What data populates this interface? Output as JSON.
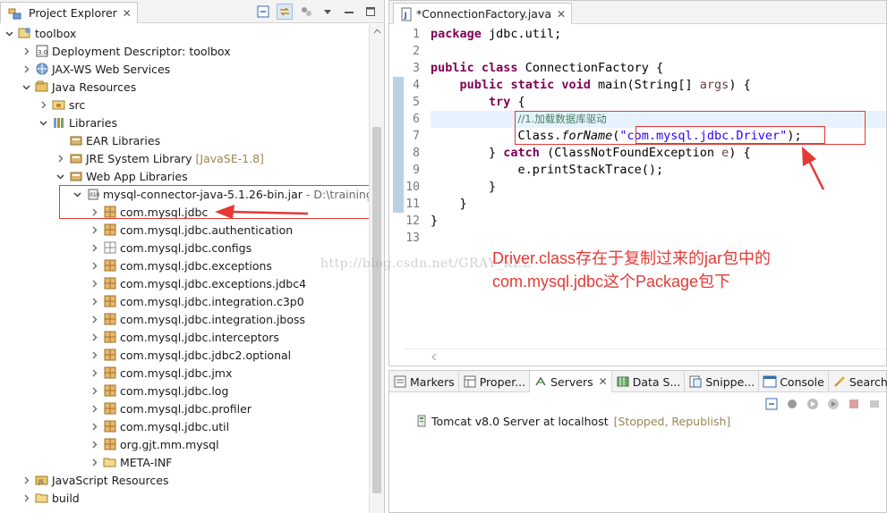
{
  "project_explorer": {
    "title": "Project Explorer",
    "close_glyph": "✕",
    "tree": [
      {
        "label": "toolbox",
        "icon": "project-icon",
        "expanded": true,
        "level": 0
      },
      {
        "label": "Deployment Descriptor: toolbox",
        "icon": "deployment-descriptor-icon",
        "expanded": false,
        "level": 1
      },
      {
        "label": "JAX-WS Web Services",
        "icon": "web-services-icon",
        "expanded": false,
        "level": 1
      },
      {
        "label": "Java Resources",
        "icon": "java-resources-icon",
        "expanded": true,
        "level": 1
      },
      {
        "label": "src",
        "icon": "source-folder-icon",
        "expanded": false,
        "level": 2
      },
      {
        "label": "Libraries",
        "icon": "libraries-icon",
        "expanded": true,
        "level": 2
      },
      {
        "label": "EAR Libraries",
        "icon": "library-icon",
        "expanded": null,
        "level": 3
      },
      {
        "label": "JRE System Library",
        "decoration": "[JavaSE-1.8]",
        "icon": "library-icon",
        "expanded": false,
        "level": 3
      },
      {
        "label": "Web App Libraries",
        "icon": "library-icon",
        "expanded": true,
        "level": 3
      },
      {
        "label": "mysql-connector-java-5.1.26-bin.jar",
        "path": "- D:\\trainingws",
        "icon": "jar-icon",
        "expanded": true,
        "level": 4
      },
      {
        "label": "com.mysql.jdbc",
        "icon": "package-icon",
        "expanded": false,
        "level": 5
      },
      {
        "label": "com.mysql.jdbc.authentication",
        "icon": "package-icon",
        "expanded": false,
        "level": 5
      },
      {
        "label": "com.mysql.jdbc.configs",
        "icon": "empty-package-icon",
        "expanded": false,
        "level": 5
      },
      {
        "label": "com.mysql.jdbc.exceptions",
        "icon": "package-icon",
        "expanded": false,
        "level": 5
      },
      {
        "label": "com.mysql.jdbc.exceptions.jdbc4",
        "icon": "package-icon",
        "expanded": false,
        "level": 5
      },
      {
        "label": "com.mysql.jdbc.integration.c3p0",
        "icon": "package-icon",
        "expanded": false,
        "level": 5
      },
      {
        "label": "com.mysql.jdbc.integration.jboss",
        "icon": "package-icon",
        "expanded": false,
        "level": 5
      },
      {
        "label": "com.mysql.jdbc.interceptors",
        "icon": "package-icon",
        "expanded": false,
        "level": 5
      },
      {
        "label": "com.mysql.jdbc.jdbc2.optional",
        "icon": "package-icon",
        "expanded": false,
        "level": 5
      },
      {
        "label": "com.mysql.jdbc.jmx",
        "icon": "package-icon",
        "expanded": false,
        "level": 5
      },
      {
        "label": "com.mysql.jdbc.log",
        "icon": "package-icon",
        "expanded": false,
        "level": 5
      },
      {
        "label": "com.mysql.jdbc.profiler",
        "icon": "package-icon",
        "expanded": false,
        "level": 5
      },
      {
        "label": "com.mysql.jdbc.util",
        "icon": "package-icon",
        "expanded": false,
        "level": 5
      },
      {
        "label": "org.gjt.mm.mysql",
        "icon": "package-icon",
        "expanded": false,
        "level": 5
      },
      {
        "label": "META-INF",
        "icon": "folder-icon",
        "expanded": false,
        "level": 5
      },
      {
        "label": "JavaScript Resources",
        "icon": "javascript-resources-icon",
        "expanded": false,
        "level": 1
      },
      {
        "label": "build",
        "icon": "folder-icon",
        "expanded": false,
        "level": 1
      }
    ]
  },
  "editor": {
    "tab_title": "*ConnectionFactory.java",
    "close_glyph": "✕",
    "line_numbers": [
      "1",
      "2",
      "3",
      "4",
      "5",
      "6",
      "7",
      "8",
      "9",
      "10",
      "11",
      "12",
      "13"
    ],
    "code": {
      "l1_kw": "package",
      "l1_rest": " jdbc.util;",
      "l3_kw1": "public",
      "l3_kw2": "class",
      "l3_rest": " ConnectionFactory {",
      "l4_kw1": "public",
      "l4_kw2": "static",
      "l4_kw3": "void",
      "l4_rest1": " main(String[] ",
      "l4_var": "args",
      "l4_rest2": ") {",
      "l5_kw": "try",
      "l5_rest": " {",
      "l6_comment": "//1.加载数据库驱动",
      "l7_a": "Class.",
      "l7_method": "forName",
      "l7_b": "(",
      "l7_str": "\"com.mysql.jdbc.Driver\"",
      "l7_c": ");",
      "l8_a": "} ",
      "l8_kw": "catch",
      "l8_b": " (ClassNotFoundException ",
      "l8_var": "e",
      "l8_c": ") {",
      "l9": "e.printStackTrace();",
      "l10": "}",
      "l11": "}",
      "l12": "}"
    }
  },
  "annotation": {
    "line1": "Driver.class存在于复制过来的jar包中的",
    "line2": "com.mysql.jdbc这个Package包下",
    "watermark": "http://blog.csdn.net/GRAY_KEL",
    "color": "#e53935"
  },
  "bottom_panel": {
    "tabs": [
      {
        "label": "Markers",
        "icon": "markers-icon",
        "active": false
      },
      {
        "label": "Proper...",
        "icon": "properties-icon",
        "active": false
      },
      {
        "label": "Servers",
        "icon": "servers-icon",
        "active": true
      },
      {
        "label": "Data S...",
        "icon": "data-source-icon",
        "active": false
      },
      {
        "label": "Snippe...",
        "icon": "snippets-icon",
        "active": false
      },
      {
        "label": "Console",
        "icon": "console-icon",
        "active": false
      },
      {
        "label": "Search",
        "icon": "search-icon",
        "active": false
      }
    ],
    "servers_close_glyph": "✕",
    "server": {
      "name": "Tomcat v8.0 Server at localhost",
      "status": "[Stopped, Republish]"
    }
  }
}
